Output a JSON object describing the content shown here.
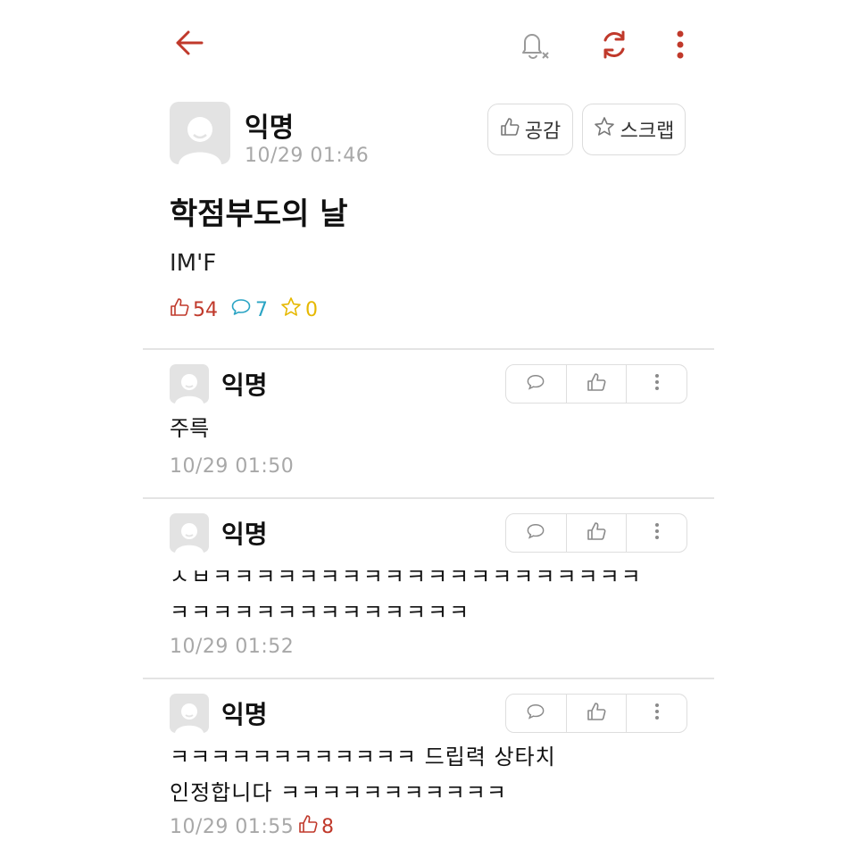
{
  "post": {
    "author": "익명",
    "date": "10/29 01:46",
    "like_button": "공감",
    "scrap_button": "스크랩",
    "title": "학점부도의 날",
    "body": "IM'F",
    "likes": "54",
    "comments": "7",
    "scraps": "0"
  },
  "comments": [
    {
      "author": "익명",
      "text": "주륵",
      "date": "10/29 01:50"
    },
    {
      "author": "익명",
      "text": "ㅅㅂㅋㅋㅋㅋㅋㅋㅋㅋㅋㅋㅋㅋㅋㅋㅋㅋㅋㅋㅋㅋ\nㅋㅋㅋㅋㅋㅋㅋㅋㅋㅋㅋㅋㅋㅋ",
      "date": "10/29 01:52"
    },
    {
      "author": "익명",
      "text": "ㅋㅋㅋㅋㅋㅋㅋㅋㅋㅋㅋㅋ 드립력 상타치\n인정합니다 ㅋㅋㅋㅋㅋㅋㅋㅋㅋㅋㅋ",
      "date": "10/29 01:55",
      "likes": "8"
    }
  ],
  "colors": {
    "accent_red": "#c0392b",
    "comment_blue": "#2aa4c4",
    "scrap_yellow": "#e6b800"
  }
}
